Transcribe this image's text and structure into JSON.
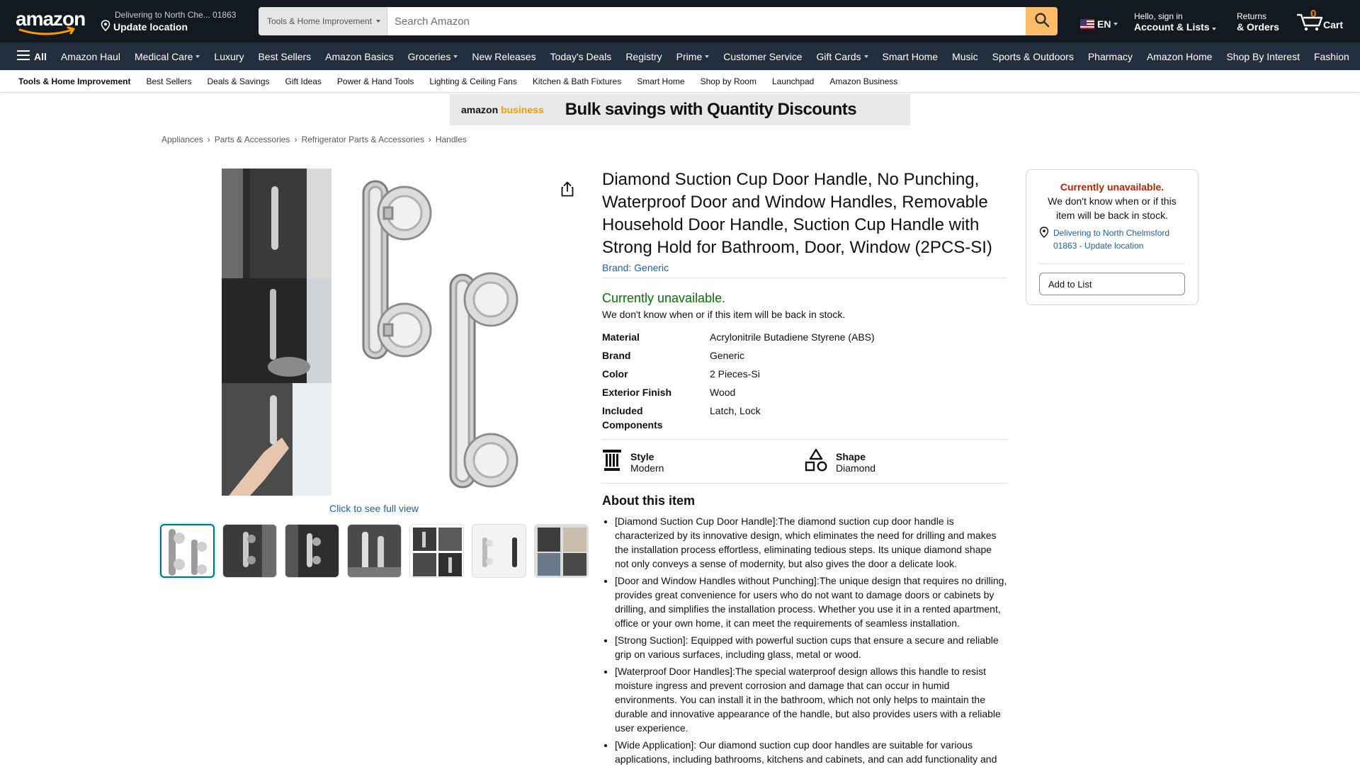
{
  "header": {
    "logo_text": "amazon",
    "deliver_small": "Delivering to North Che... 01863",
    "deliver_big": "Update location",
    "search_category": "Tools & Home Improvement",
    "search_placeholder": "Search Amazon",
    "lang": "EN",
    "account_small": "Hello, sign in",
    "account_big": "Account & Lists",
    "returns_small": "Returns",
    "returns_big": "& Orders",
    "cart_count": "0",
    "cart_label": "Cart"
  },
  "nav_main": [
    "All",
    "Amazon Haul",
    "Medical Care",
    "Luxury",
    "Best Sellers",
    "Amazon Basics",
    "Groceries",
    "New Releases",
    "Today's Deals",
    "Registry",
    "Prime",
    "Customer Service",
    "Gift Cards",
    "Smart Home",
    "Music",
    "Sports & Outdoors",
    "Pharmacy",
    "Amazon Home",
    "Shop By Interest",
    "Fashion"
  ],
  "nav_sub": [
    "Tools & Home Improvement",
    "Best Sellers",
    "Deals & Savings",
    "Gift Ideas",
    "Power & Hand Tools",
    "Lighting & Ceiling Fans",
    "Kitchen & Bath Fixtures",
    "Smart Home",
    "Shop by Room",
    "Launchpad",
    "Amazon Business"
  ],
  "banner": {
    "brand_a": "amazon",
    "brand_b": "business",
    "text": "Bulk savings with Quantity Discounts"
  },
  "breadcrumb": [
    "Appliances",
    "Parts & Accessories",
    "Refrigerator Parts & Accessories",
    "Handles"
  ],
  "product": {
    "title": "Diamond Suction Cup Door Handle, No Punching, Waterproof Door and Window Handles, Removable Household Door Handle, Suction Cup Handle with Strong Hold for Bathroom, Door, Window (2PCS-SI)",
    "brand": "Brand: Generic",
    "availability": "Currently unavailable.",
    "availability_note": "We don't know when or if this item will be back in stock.",
    "full_view": "Click to see full view",
    "specs": [
      {
        "k": "Material",
        "v": "Acrylonitrile Butadiene Styrene (ABS)"
      },
      {
        "k": "Brand",
        "v": "Generic"
      },
      {
        "k": "Color",
        "v": "2 Pieces-Si"
      },
      {
        "k": "Exterior Finish",
        "v": "Wood"
      },
      {
        "k": "Included Components",
        "v": "Latch, Lock"
      }
    ],
    "features": [
      {
        "k": "Style",
        "v": "Modern",
        "icon": "column-icon"
      },
      {
        "k": "Shape",
        "v": "Diamond",
        "icon": "shapes-icon"
      }
    ],
    "about_heading": "About this item",
    "bullets": [
      "[Diamond Suction Cup Door Handle]:The diamond suction cup door handle is characterized by its innovative design, which eliminates the need for drilling and makes the installation process effortless, eliminating tedious steps. Its unique diamond shape not only conveys a sense of modernity, but also gives the door a delicate look.",
      "[Door and Window Handles without Punching]:The unique design that requires no drilling, provides great convenience for users who do not want to damage doors or cabinets by drilling, and simplifies the installation process. Whether you use it in a rented apartment, office or your own home, it can meet the requirements of seamless installation.",
      "[Strong Suction]: Equipped with powerful suction cups that ensure a secure and reliable grip on various surfaces, including glass, metal or wood.",
      "[Waterproof Door Handles]:The special waterproof design allows this handle to resist moisture ingress and prevent corrosion and damage that can occur in humid environments. You can install it in the bathroom, which not only helps to maintain the durable and innovative appearance of the handle, but also provides users with a reliable user experience.",
      "[Wide Application]: Our diamond suction cup door handles are suitable for various applications, including bathrooms, kitchens and cabinets, and can add functionality and"
    ]
  },
  "buybox": {
    "unavail": "Currently unavailable.",
    "note": "We don't know when or if this item will be back in stock.",
    "location": "Delivering to North Chelmsford 01863 - Update location",
    "add_to_list": "Add to List"
  },
  "colors": {
    "nav_top": "#131921",
    "nav_main": "#232f3e",
    "search_btn": "#febd69",
    "link": "#2162a1",
    "in_stock_green": "#007600",
    "unavail_red": "#b12704"
  }
}
